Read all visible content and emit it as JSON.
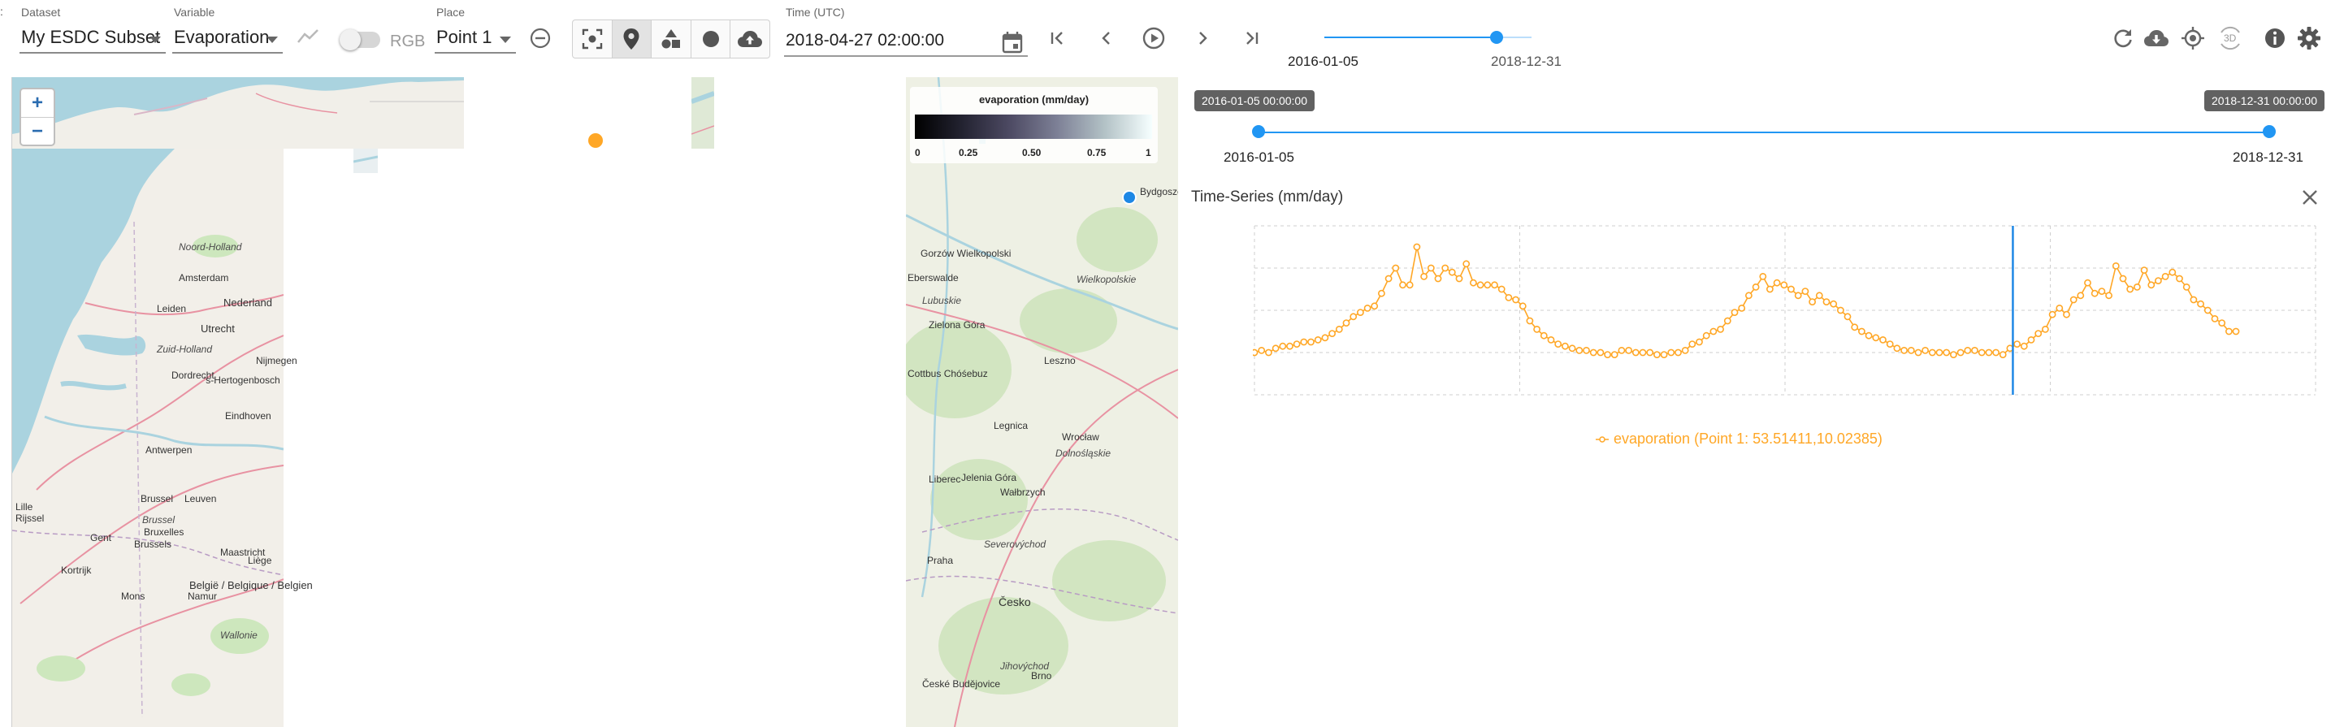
{
  "toolbar": {
    "edge_glyph": ":",
    "dataset": {
      "label": "Dataset",
      "value": "My ESDC Subset"
    },
    "variable": {
      "label": "Variable",
      "value": "Evaporation"
    },
    "rgb_label": "RGB",
    "place": {
      "label": "Place",
      "value": "Point 1"
    },
    "time": {
      "label": "Time (UTC)",
      "value": "2018-04-27 02:00:00"
    },
    "time_range": {
      "start": "2016-01-05",
      "end": "2018-12-31",
      "position": 0.83
    }
  },
  "map": {
    "zoom_in": "+",
    "zoom_out": "−",
    "colorbar": {
      "title": "evaporation (mm/day)",
      "ticks": [
        "0",
        "0.25",
        "0.50",
        "0.75",
        "1"
      ]
    },
    "labels": [
      {
        "text": "Noord-Holland",
        "kind": "region"
      },
      {
        "text": "Amsterdam",
        "kind": "city"
      },
      {
        "text": "Leiden",
        "kind": "city"
      },
      {
        "text": "Utrecht",
        "kind": "city"
      },
      {
        "text": "Nederland",
        "kind": "country"
      },
      {
        "text": "Zuid-Holland",
        "kind": "region"
      },
      {
        "text": "Dordrecht",
        "kind": "city"
      },
      {
        "text": "Nijmegen",
        "kind": "city"
      },
      {
        "text": "'s-Hertogenbosch",
        "kind": "city"
      },
      {
        "text": "Eindhoven",
        "kind": "city"
      },
      {
        "text": "Antwerpen",
        "kind": "city"
      },
      {
        "text": "Brussel",
        "kind": "city"
      },
      {
        "text": "Brussel",
        "kind": "region"
      },
      {
        "text": "Bruxelles",
        "kind": "city"
      },
      {
        "text": "Brussels",
        "kind": "city"
      },
      {
        "text": "Leuven",
        "kind": "city"
      },
      {
        "text": "Liège",
        "kind": "city"
      },
      {
        "text": "Maastricht",
        "kind": "city"
      },
      {
        "text": "Mons",
        "kind": "city"
      },
      {
        "text": "Namur",
        "kind": "city"
      },
      {
        "text": "België / Belgique / Belgien",
        "kind": "country"
      },
      {
        "text": "Wallonie",
        "kind": "region"
      },
      {
        "text": "Lille",
        "kind": "city"
      },
      {
        "text": "Rijssel",
        "kind": "city"
      },
      {
        "text": "Kortrijk",
        "kind": "city"
      },
      {
        "text": "Gent",
        "kind": "city"
      },
      {
        "text": "Gorzów Wielkopolski",
        "kind": "city"
      },
      {
        "text": "Eberswalde",
        "kind": "city"
      },
      {
        "text": "Lubuskie",
        "kind": "region"
      },
      {
        "text": "Zielona Góra",
        "kind": "city"
      },
      {
        "text": "Wielkopolskie",
        "kind": "region"
      },
      {
        "text": "Leszno",
        "kind": "city"
      },
      {
        "text": "Cottbus Chóśebuz",
        "kind": "city"
      },
      {
        "text": "Legnica",
        "kind": "city"
      },
      {
        "text": "Wrocław",
        "kind": "city"
      },
      {
        "text": "Dolnośląskie",
        "kind": "region"
      },
      {
        "text": "Liberec",
        "kind": "city"
      },
      {
        "text": "Jelenia Góra",
        "kind": "city"
      },
      {
        "text": "Wałbrzych",
        "kind": "city"
      },
      {
        "text": "Severovýchod",
        "kind": "region"
      },
      {
        "text": "Praha",
        "kind": "city"
      },
      {
        "text": "Česko",
        "kind": "country"
      },
      {
        "text": "Jihovýchod",
        "kind": "region"
      },
      {
        "text": "České Budějovice",
        "kind": "city"
      },
      {
        "text": "Brno",
        "kind": "city"
      },
      {
        "text": "Bydgoszcz",
        "kind": "city"
      }
    ]
  },
  "right_toolbar": {
    "three_d_label": "3D"
  },
  "timeline": {
    "start_label": "2016-01-05",
    "end_label": "2018-12-31",
    "start_tooltip": "2016-01-05 00:00:00",
    "end_tooltip": "2018-12-31 00:00:00"
  },
  "timeseries": {
    "title": "Time-Series (mm/day)",
    "series_label": "evaporation (Point 1: 53.51411,10.02385)",
    "series_color": "#ffa726",
    "cursor_color": "#1e88e5"
  },
  "colors": {
    "accent": "#2196f3",
    "place_marker": "#ffa726",
    "selected_marker": "#1e88e5"
  },
  "chart_data": {
    "type": "line",
    "title": "Time-Series (mm/day)",
    "x_range": [
      "2016-01-05",
      "2018-12-31"
    ],
    "grid": true,
    "cursor_x": "2018-04-27",
    "series": [
      {
        "name": "evaporation (Point 1: 53.51411,10.02385)",
        "color": "#ffa726",
        "values": [
          0.2,
          0.21,
          0.2,
          0.22,
          0.23,
          0.23,
          0.24,
          0.25,
          0.25,
          0.26,
          0.27,
          0.29,
          0.31,
          0.34,
          0.37,
          0.39,
          0.41,
          0.42,
          0.48,
          0.55,
          0.6,
          0.52,
          0.52,
          0.7,
          0.56,
          0.6,
          0.55,
          0.6,
          0.58,
          0.55,
          0.62,
          0.53,
          0.52,
          0.52,
          0.52,
          0.5,
          0.46,
          0.45,
          0.42,
          0.35,
          0.31,
          0.28,
          0.26,
          0.24,
          0.23,
          0.22,
          0.21,
          0.21,
          0.2,
          0.2,
          0.19,
          0.19,
          0.21,
          0.21,
          0.2,
          0.2,
          0.2,
          0.19,
          0.19,
          0.2,
          0.2,
          0.21,
          0.24,
          0.25,
          0.28,
          0.3,
          0.31,
          0.35,
          0.39,
          0.41,
          0.47,
          0.51,
          0.56,
          0.5,
          0.53,
          0.52,
          0.5,
          0.47,
          0.49,
          0.44,
          0.47,
          0.44,
          0.43,
          0.4,
          0.37,
          0.32,
          0.3,
          0.28,
          0.27,
          0.26,
          0.24,
          0.22,
          0.21,
          0.21,
          0.2,
          0.21,
          0.2,
          0.2,
          0.2,
          0.19,
          0.2,
          0.21,
          0.21,
          0.2,
          0.2,
          0.2,
          0.19,
          0.22,
          0.24,
          0.23,
          0.26,
          0.29,
          0.31,
          0.38,
          0.41,
          0.38,
          0.45,
          0.47,
          0.53,
          0.48,
          0.49,
          0.47,
          0.61,
          0.55,
          0.5,
          0.51,
          0.59,
          0.52,
          0.54,
          0.56,
          0.58,
          0.55,
          0.51,
          0.45,
          0.43,
          0.4,
          0.36,
          0.34,
          0.3,
          0.3
        ]
      }
    ]
  }
}
